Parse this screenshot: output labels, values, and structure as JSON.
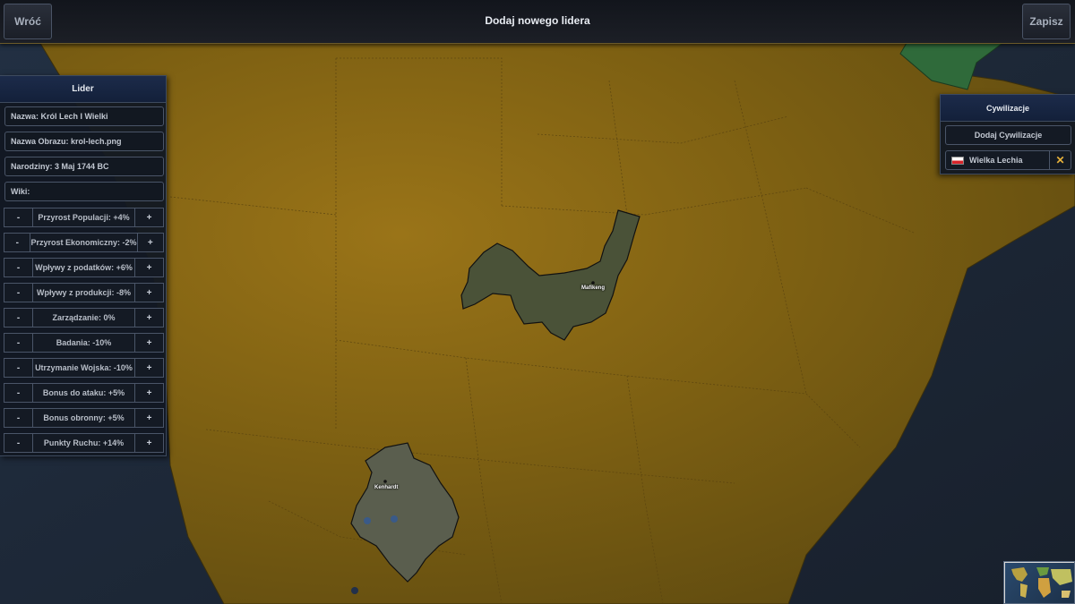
{
  "topbar": {
    "back_label": "Wróć",
    "title": "Dodaj nowego lidera",
    "save_label": "Zapisz"
  },
  "leader_panel": {
    "title": "Lider",
    "fields": [
      "Nazwa: Król Lech I Wielki",
      "Nazwa Obrazu: krol-lech.png",
      "Narodziny: 3 Maj 1744 BC",
      "Wiki:"
    ],
    "stats": [
      {
        "label": "Przyrost Populacji: +4%"
      },
      {
        "label": "Przyrost Ekonomiczny: -2%"
      },
      {
        "label": "Wpływy z podatków: +6%"
      },
      {
        "label": "Wpływy z produkcji: -8%"
      },
      {
        "label": "Zarządzanie: 0%"
      },
      {
        "label": "Badania: -10%"
      },
      {
        "label": "Utrzymanie Wojska: -10%"
      },
      {
        "label": "Bonus do ataku: +5%"
      },
      {
        "label": "Bonus obronny: +5%"
      },
      {
        "label": "Punkty Ruchu: +14%"
      }
    ],
    "minus": "-",
    "plus": "+"
  },
  "civ_panel": {
    "title": "Cywilizacje",
    "add_label": "Dodaj Cywilizacje",
    "civs": [
      {
        "name": "Wielka Lechia",
        "remove": "✕"
      }
    ]
  },
  "map": {
    "cities": [
      "Mafikeng",
      "Kenhardt"
    ]
  },
  "colors": {
    "ocean": "#1b2535",
    "land": "#8a6a14",
    "selected_region": "#4a5238",
    "accent": "#e8b23a"
  }
}
